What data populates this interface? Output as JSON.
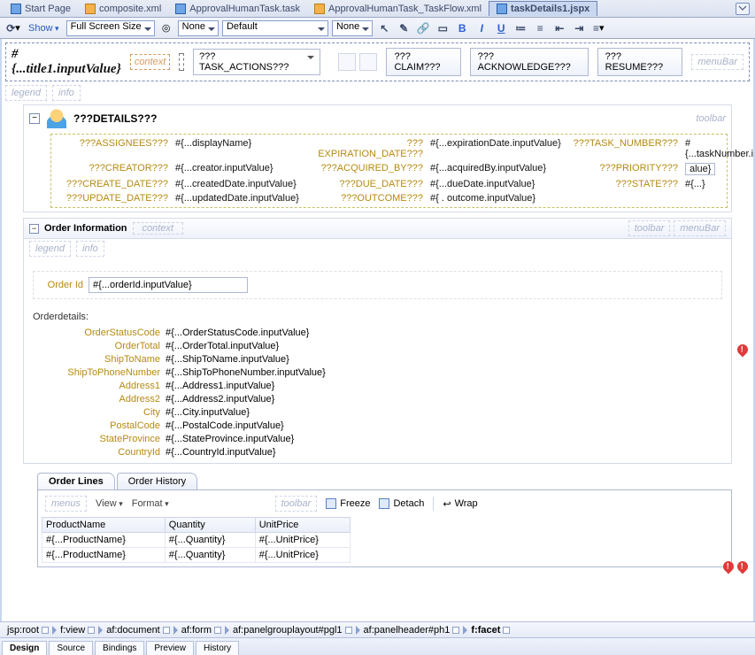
{
  "editor_tabs": [
    {
      "label": "Start Page",
      "icon": "start"
    },
    {
      "label": "composite.xml",
      "icon": "xml"
    },
    {
      "label": "ApprovalHumanTask.task",
      "icon": "task"
    },
    {
      "label": "ApprovalHumanTask_TaskFlow.xml",
      "icon": "flow"
    },
    {
      "label": "taskDetails1.jspx",
      "icon": "jsp",
      "active": true
    }
  ],
  "format_bar": {
    "show_label": "Show",
    "size_select": "Full Screen Size",
    "sel_none1": "None",
    "sel_default": "Default",
    "sel_none2": "None"
  },
  "title_row": {
    "title_expr": "#{...title1.inputValue}",
    "context_facet": "context",
    "task_actions_dd": "???TASK_ACTIONS???",
    "claim_btn": "???CLAIM???",
    "ack_btn": "???ACKNOWLEDGE???",
    "resume_btn": "???RESUME???",
    "menubar_facet": "menuBar"
  },
  "legend_row": {
    "legend": "legend",
    "info": "info"
  },
  "details_panel": {
    "title": "???DETAILS???",
    "toolbar_facet": "toolbar",
    "rows": {
      "assignees_lbl": "???ASSIGNEES???",
      "assignees_val": "#{...displayName}",
      "creator_lbl": "???CREATOR???",
      "creator_val": "#{...creator.inputValue}",
      "createdate_lbl": "???CREATE_DATE???",
      "createdate_val": "#{...createdDate.inputValue}",
      "updatedate_lbl": "???UPDATE_DATE???",
      "updatedate_val": "#{...updatedDate.inputValue}",
      "expdate_lbl": "???EXPIRATION_DATE???",
      "expdate_val": "#{...expirationDate.inputValue}",
      "acqby_lbl": "???ACQUIRED_BY???",
      "acqby_val": "#{...acquiredBy.inputValue}",
      "duedate_lbl": "???DUE_DATE???",
      "duedate_val": "#{...dueDate.inputValue}",
      "outcome_lbl": "???OUTCOME???",
      "outcome_val": "#{ . outcome.inputValue}",
      "tasknum_lbl": "???TASK_NUMBER???",
      "tasknum_val": "#{...taskNumber.inputValue}",
      "priority_lbl": "???PRIORITY???",
      "priority_val": "alue}",
      "state_lbl": "???STATE???",
      "state_val": "#{...}"
    }
  },
  "order_info": {
    "header": "Order Information",
    "context_facet": "context",
    "toolbar_facet": "toolbar",
    "menubar_facet": "menuBar",
    "legend": "legend",
    "info": "info",
    "orderid_label": "Order Id",
    "orderid_value": "#{...orderId.inputValue}",
    "subtitle": "Orderdetails:",
    "fields": [
      {
        "k": "OrderStatusCode",
        "v": "#{...OrderStatusCode.inputValue}"
      },
      {
        "k": "OrderTotal",
        "v": "#{...OrderTotal.inputValue}"
      },
      {
        "k": "ShipToName",
        "v": "#{...ShipToName.inputValue}"
      },
      {
        "k": "ShipToPhoneNumber",
        "v": "#{...ShipToPhoneNumber.inputValue}"
      },
      {
        "k": "Address1",
        "v": "#{...Address1.inputValue}"
      },
      {
        "k": "Address2",
        "v": "#{...Address2.inputValue}"
      },
      {
        "k": "City",
        "v": "#{...City.inputValue}"
      },
      {
        "k": "PostalCode",
        "v": "#{...PostalCode.inputValue}"
      },
      {
        "k": "StateProvince",
        "v": "#{...StateProvince.inputValue}"
      },
      {
        "k": "CountryId",
        "v": "#{...CountryId.inputValue}"
      }
    ]
  },
  "lines_panel": {
    "tab_lines": "Order Lines",
    "tab_history": "Order History",
    "menus_facet": "menus",
    "view_menu": "View",
    "format_menu": "Format",
    "toolbar_facet": "toolbar",
    "freeze": "Freeze",
    "detach": "Detach",
    "wrap": "Wrap",
    "cols": [
      "ProductName",
      "Quantity",
      "UnitPrice"
    ],
    "row0": [
      "#{...ProductName}",
      "#{...Quantity}",
      "#{...UnitPrice}"
    ],
    "row1": [
      "#{...ProductName}",
      "#{...Quantity}",
      "#{...UnitPrice}"
    ]
  },
  "breadcrumb": [
    "jsp:root",
    "f:view",
    "af:document",
    "af:form",
    "af:panelgrouplayout#pgl1",
    "af:panelheader#ph1",
    "f:facet"
  ],
  "bottom_modes": [
    "Design",
    "Source",
    "Bindings",
    "Preview",
    "History"
  ]
}
